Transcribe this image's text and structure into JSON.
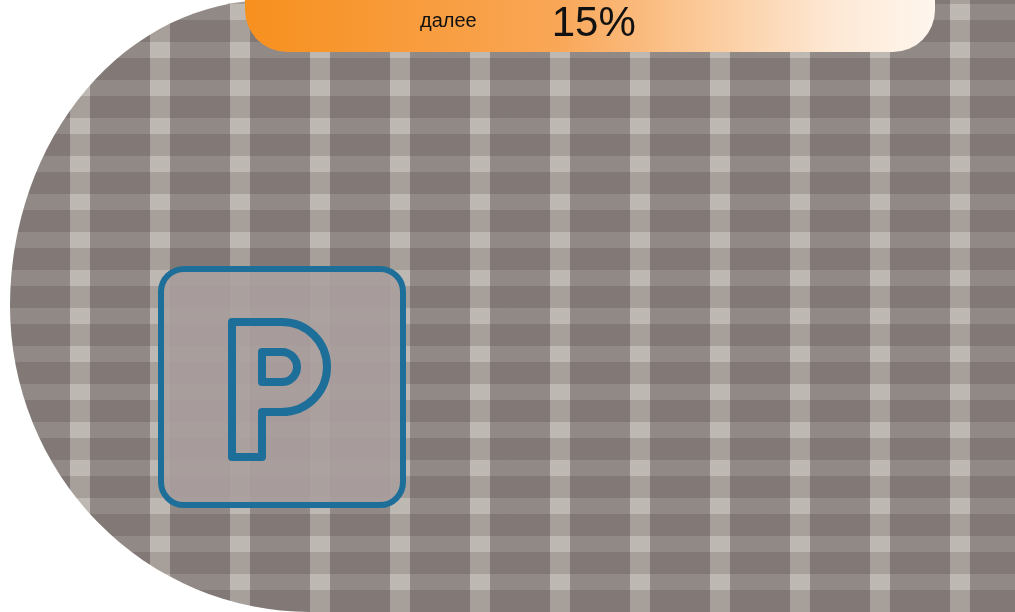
{
  "promo_banner": {
    "caption": "далее",
    "discount": "15%"
  }
}
